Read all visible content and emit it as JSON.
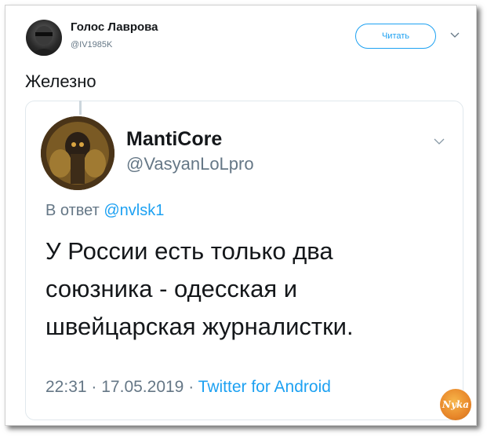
{
  "tweet": {
    "author": {
      "name": "Голос Лаврова",
      "handle": "@IV1985K",
      "avatar_icon": "user-avatar"
    },
    "follow_label": "Читать",
    "menu_icon": "chevron-down-icon",
    "text": "Железно"
  },
  "quoted_tweet": {
    "author": {
      "name": "MantiCore",
      "handle": "@VasyanLoLpro",
      "avatar_icon": "user-avatar"
    },
    "menu_icon": "chevron-down-icon",
    "reply_prefix": "В ответ",
    "reply_to": "@nvlsk1",
    "text": "У России есть только два союзника - одесская и швейцарская журналистки.",
    "time": "22:31",
    "date": "17.05.2019",
    "separator": "·",
    "source": "Twitter for Android"
  },
  "watermark": {
    "text": "Nyka"
  },
  "colors": {
    "link": "#1da1f2",
    "secondary": "#657786",
    "border": "#e1e8ed",
    "text": "#14171a"
  }
}
